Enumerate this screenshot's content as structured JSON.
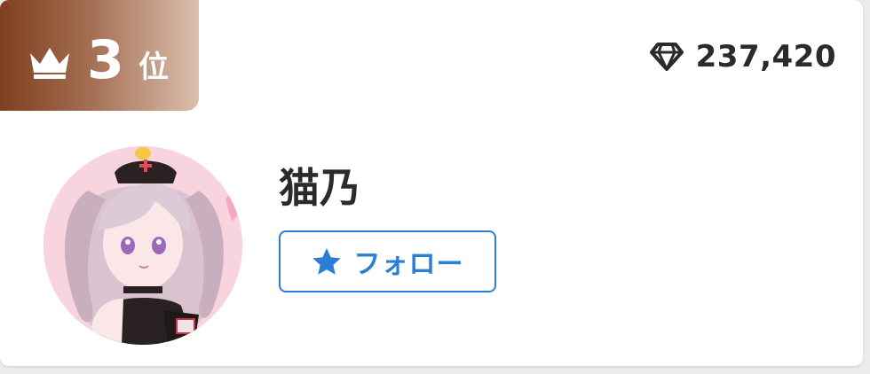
{
  "ranking": {
    "rank_number": "3",
    "rank_suffix": "位",
    "crown_icon": "crown-icon",
    "badge_colors": [
      "#7e3f1f",
      "#dbbfae"
    ]
  },
  "score": {
    "icon": "diamond-icon",
    "value": "237,420"
  },
  "user": {
    "name": "猫乃",
    "avatar": "avatar"
  },
  "follow_button": {
    "icon": "star-icon",
    "label": "フォロー",
    "color": "#2a7fd4"
  }
}
